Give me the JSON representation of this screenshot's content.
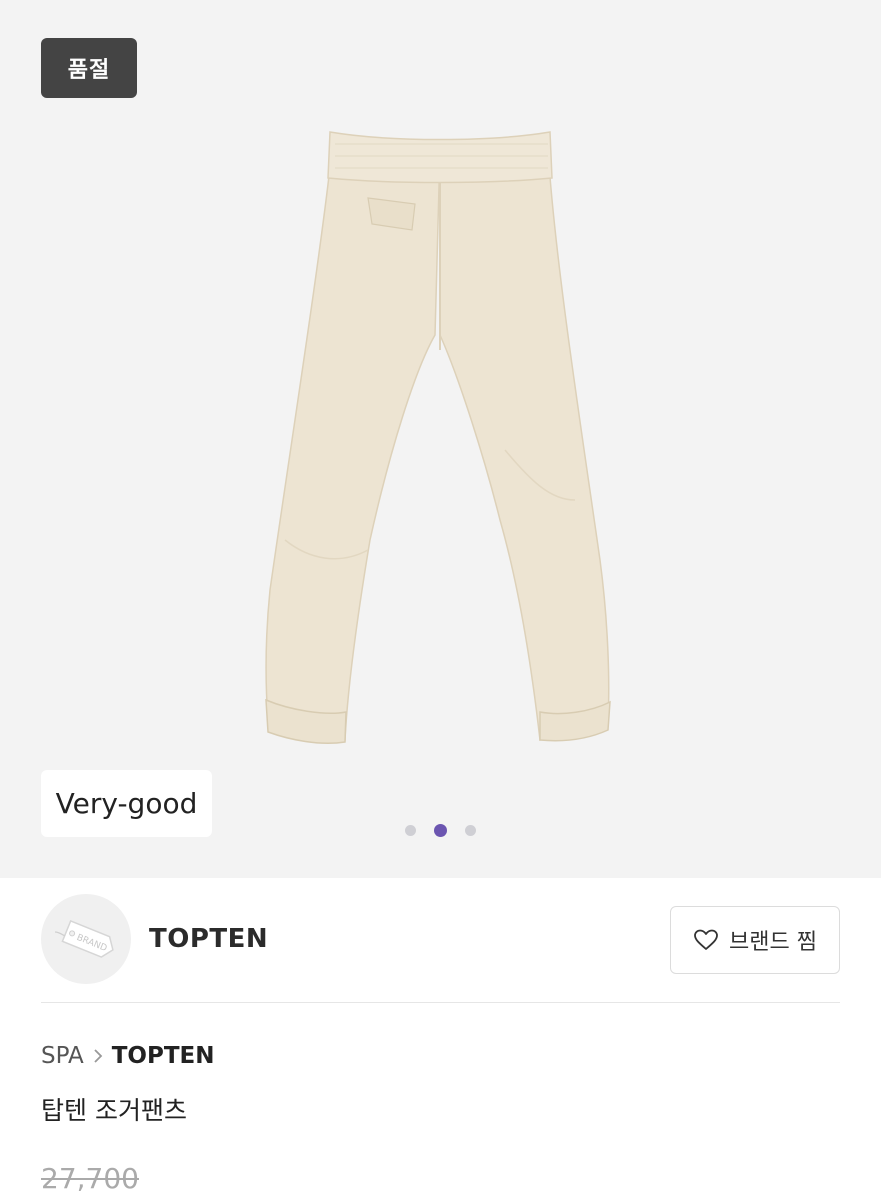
{
  "gallery": {
    "soldout_badge": "품절",
    "condition_badge": "Very-good",
    "image_alt": "beige jogger pants back view",
    "slide_count": 3,
    "active_slide": 2,
    "colors": {
      "background": "#f3f3f3",
      "active_dot": "#6b55b0",
      "inactive_dot": "#cfcfd4",
      "product": "#ede4d2"
    }
  },
  "brand": {
    "name": "TOPTEN",
    "logo_text": "BRAND",
    "fav_button_label": "브랜드 찜"
  },
  "breadcrumb": {
    "category": "SPA",
    "brand": "TOPTEN"
  },
  "product": {
    "title": "탑텐 조거팬츠",
    "original_price": "27,700"
  }
}
